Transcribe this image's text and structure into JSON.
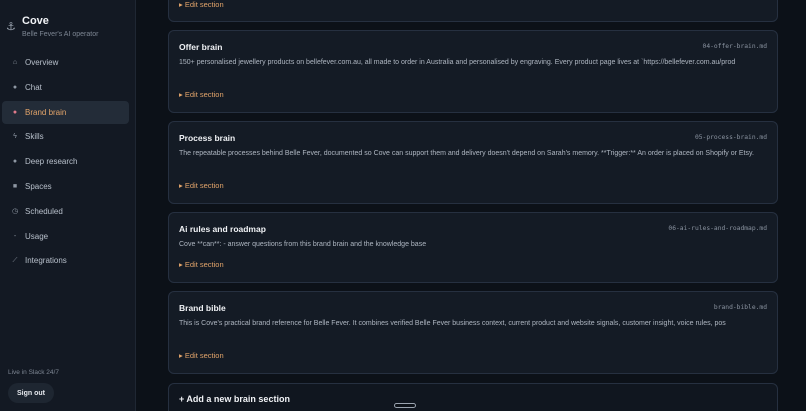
{
  "brand": {
    "name": "Cove",
    "subtitle": "Belle Fever's AI operator",
    "icon": "anchor-icon"
  },
  "nav": [
    {
      "label": "Overview",
      "icon": "home-icon",
      "glyph": "⌂",
      "active": false
    },
    {
      "label": "Chat",
      "icon": "chat-bubble-icon",
      "glyph": "●",
      "active": false
    },
    {
      "label": "Brand brain",
      "icon": "brain-icon",
      "glyph": "●",
      "active": true
    },
    {
      "label": "Skills",
      "icon": "lightning-icon",
      "glyph": "ϟ",
      "active": false
    },
    {
      "label": "Deep research",
      "icon": "magnifier-icon",
      "glyph": "●",
      "active": false
    },
    {
      "label": "Spaces",
      "icon": "box-icon",
      "glyph": "■",
      "active": false
    },
    {
      "label": "Scheduled",
      "icon": "clock-icon",
      "glyph": "◷",
      "active": false
    },
    {
      "label": "Usage",
      "icon": "usage-icon",
      "glyph": "-",
      "active": false
    },
    {
      "label": "Integrations",
      "icon": "plug-icon",
      "glyph": "⟋",
      "active": false
    }
  ],
  "footer": {
    "status": "Live in Slack 24/7",
    "signout_label": "Sign out"
  },
  "edit_label": "▸ Edit section",
  "sections": [
    {
      "title": "Offer brain",
      "file": "04-offer-brain.md",
      "body": "150+ personalised jewellery products on bellefever.com.au, all made to order in Australia and personalised by engraving. Every product page lives at `https://bellefever.com.au/prod"
    },
    {
      "title": "Process brain",
      "file": "05-process-brain.md",
      "body": "The repeatable processes behind Belle Fever, documented so Cove can support them and delivery doesn't depend on Sarah's memory. **Trigger:** An order is placed on Shopify or Etsy."
    },
    {
      "title": "Ai rules and roadmap",
      "file": "06-ai-rules-and-roadmap.md",
      "body": "Cove **can**: - answer questions from this brand brain and the knowledge base"
    },
    {
      "title": "Brand bible",
      "file": "brand-bible.md",
      "body": "This is Cove's practical brand reference for Belle Fever. It combines verified Belle Fever business context, current product and website signals, customer insight, voice rules, pos"
    }
  ],
  "add_section_label": "+ Add a new brain section"
}
